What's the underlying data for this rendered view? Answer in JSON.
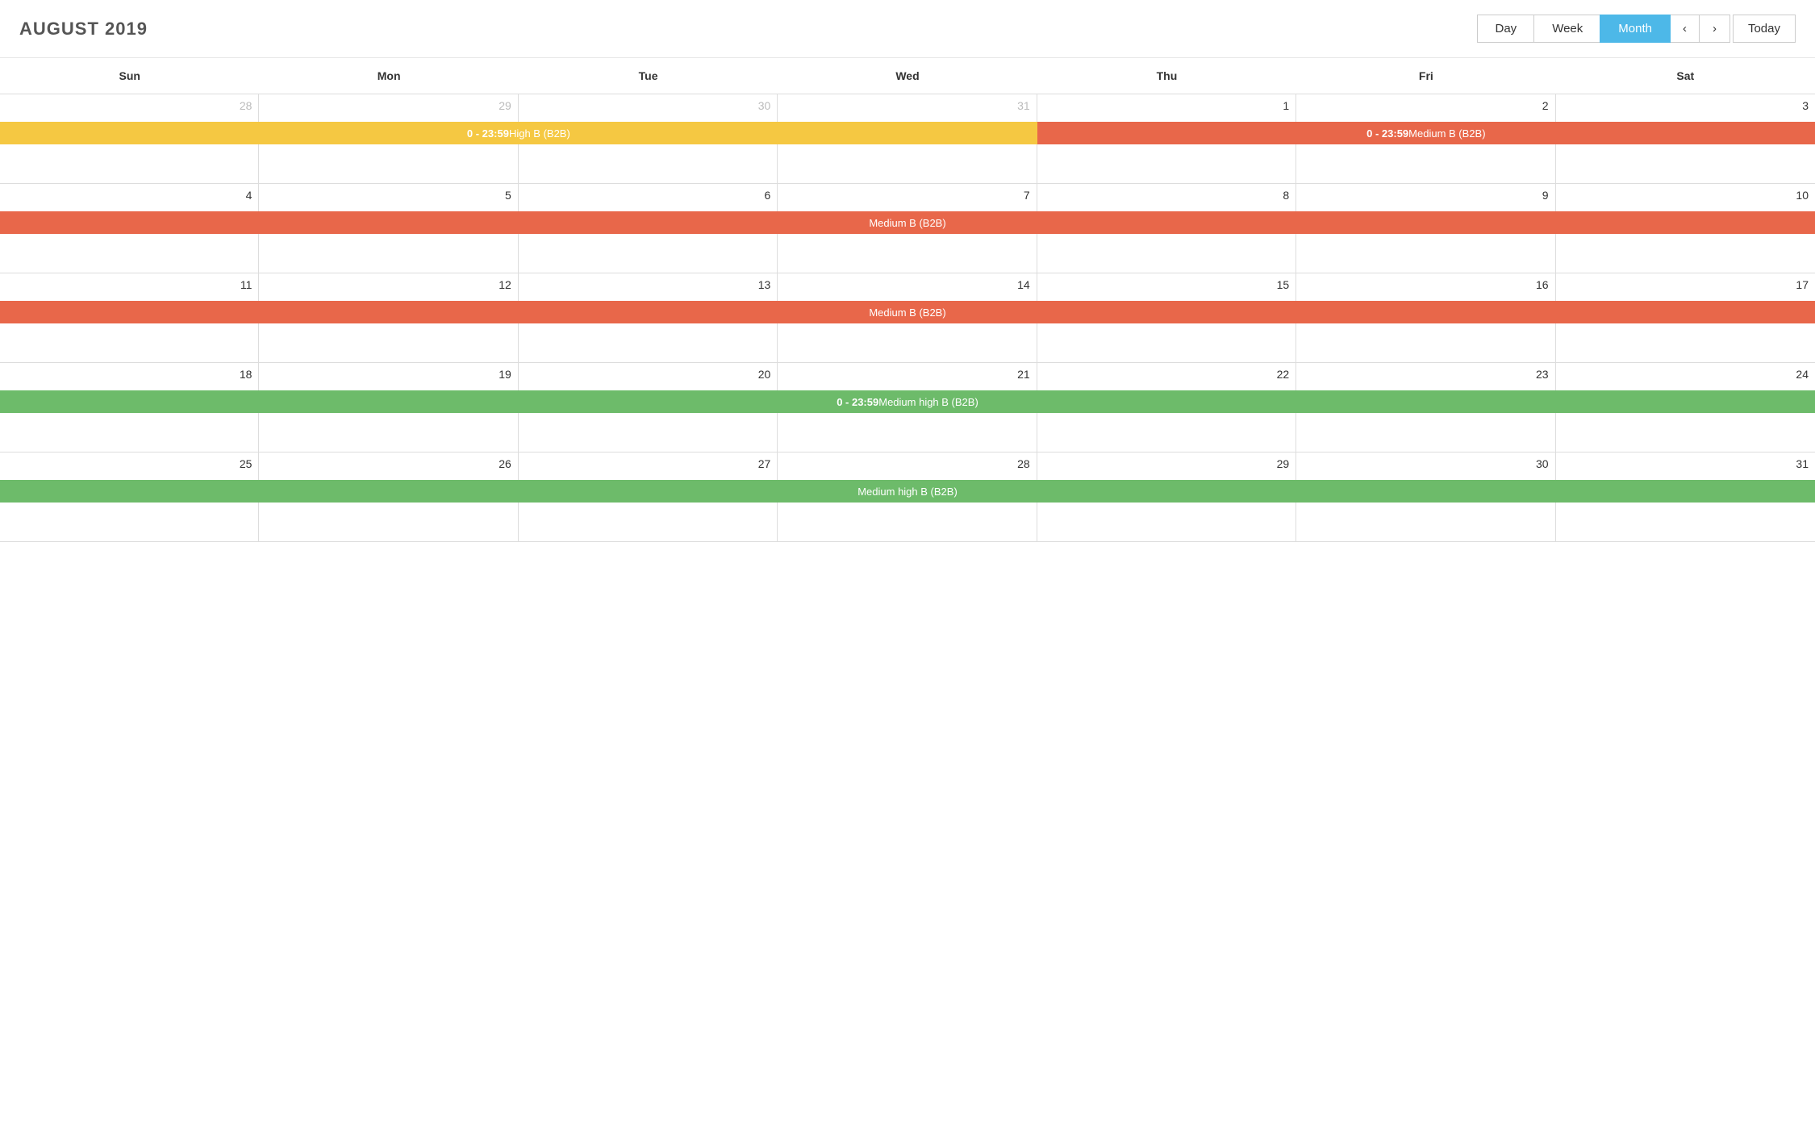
{
  "header": {
    "title": "AUGUST 2019",
    "view_day": "Day",
    "view_week": "Week",
    "view_month": "Month",
    "nav_prev": "‹",
    "nav_next": "›",
    "today": "Today"
  },
  "days_of_week": [
    "Sun",
    "Mon",
    "Tue",
    "Wed",
    "Thu",
    "Fri",
    "Sat"
  ],
  "weeks": [
    {
      "days": [
        {
          "num": "28",
          "faded": true
        },
        {
          "num": "29",
          "faded": true
        },
        {
          "num": "30",
          "faded": true
        },
        {
          "num": "31",
          "faded": true
        },
        {
          "num": "1",
          "faded": false
        },
        {
          "num": "2",
          "faded": false
        },
        {
          "num": "3",
          "faded": false
        }
      ],
      "events": [
        {
          "label": "0 - 23:59 High B (B2B)",
          "color": "yellow",
          "col_start": 0,
          "col_end": 3,
          "bold_part": "0 - 23:59"
        },
        {
          "label": "0 - 23:59 Medium B (B2B)",
          "color": "orange",
          "col_start": 4,
          "col_end": 6,
          "bold_part": "0 - 23:59"
        }
      ]
    },
    {
      "days": [
        {
          "num": "4",
          "faded": false
        },
        {
          "num": "5",
          "faded": false
        },
        {
          "num": "6",
          "faded": false
        },
        {
          "num": "7",
          "faded": false
        },
        {
          "num": "8",
          "faded": false
        },
        {
          "num": "9",
          "faded": false
        },
        {
          "num": "10",
          "faded": false
        }
      ],
      "events": [
        {
          "label": "Medium B (B2B)",
          "color": "orange",
          "col_start": 0,
          "col_end": 6,
          "bold_part": ""
        }
      ]
    },
    {
      "days": [
        {
          "num": "11",
          "faded": false
        },
        {
          "num": "12",
          "faded": false
        },
        {
          "num": "13",
          "faded": false
        },
        {
          "num": "14",
          "faded": false
        },
        {
          "num": "15",
          "faded": false
        },
        {
          "num": "16",
          "faded": false
        },
        {
          "num": "17",
          "faded": false
        }
      ],
      "events": [
        {
          "label": "Medium B (B2B)",
          "color": "orange",
          "col_start": 0,
          "col_end": 6,
          "bold_part": ""
        }
      ]
    },
    {
      "days": [
        {
          "num": "18",
          "faded": false
        },
        {
          "num": "19",
          "faded": false
        },
        {
          "num": "20",
          "faded": false
        },
        {
          "num": "21",
          "faded": false
        },
        {
          "num": "22",
          "faded": false
        },
        {
          "num": "23",
          "faded": false
        },
        {
          "num": "24",
          "faded": false
        }
      ],
      "events": [
        {
          "label": "0 - 23:59 Medium high B (B2B)",
          "color": "green",
          "col_start": 0,
          "col_end": 6,
          "bold_part": "0 - 23:59"
        }
      ]
    },
    {
      "days": [
        {
          "num": "25",
          "faded": false
        },
        {
          "num": "26",
          "faded": false
        },
        {
          "num": "27",
          "faded": false
        },
        {
          "num": "28",
          "faded": false
        },
        {
          "num": "29",
          "faded": false
        },
        {
          "num": "30",
          "faded": false
        },
        {
          "num": "31",
          "faded": false
        }
      ],
      "events": [
        {
          "label": "Medium high B (B2B)",
          "color": "green",
          "col_start": 0,
          "col_end": 6,
          "bold_part": ""
        }
      ]
    }
  ]
}
